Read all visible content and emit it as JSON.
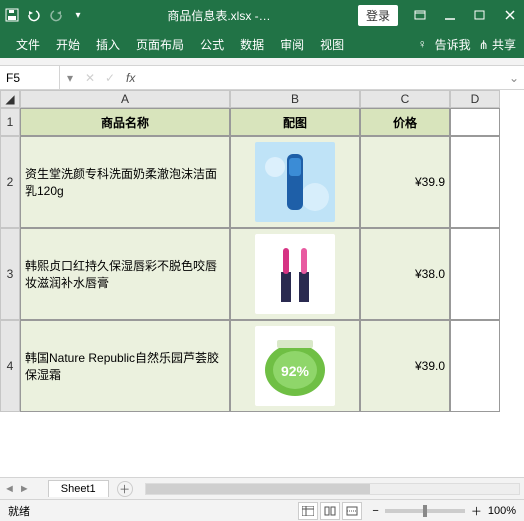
{
  "titlebar": {
    "filename": "商品信息表.xlsx -…",
    "login": "登录"
  },
  "ribbon": {
    "tabs": [
      "文件",
      "开始",
      "插入",
      "页面布局",
      "公式",
      "数据",
      "审阅",
      "视图"
    ],
    "tell_me": "告诉我",
    "share": "共享"
  },
  "formula_bar": {
    "name_box": "F5",
    "formula": ""
  },
  "grid": {
    "col_headers": [
      "A",
      "B",
      "C",
      "D"
    ],
    "row_headers": [
      "1",
      "2",
      "3",
      "4"
    ],
    "headers": [
      "商品名称",
      "配图",
      "价格"
    ],
    "rows": [
      {
        "name": "资生堂洗颜专科洗面奶柔澈泡沫洁面乳120g",
        "price": "¥39.9"
      },
      {
        "name": "韩熙贞口红持久保湿唇彩不脱色咬唇妆滋润补水唇膏",
        "price": "¥38.0"
      },
      {
        "name": "韩国Nature Republic自然乐园芦荟胶保湿霜",
        "price": "¥39.0"
      }
    ]
  },
  "sheets": {
    "active": "Sheet1"
  },
  "statusbar": {
    "status": "就绪",
    "zoom": "100%"
  },
  "icons": {
    "search": "🔍",
    "bulb": "♀",
    "share": "⋔",
    "minus": "−",
    "plus": "＋"
  }
}
